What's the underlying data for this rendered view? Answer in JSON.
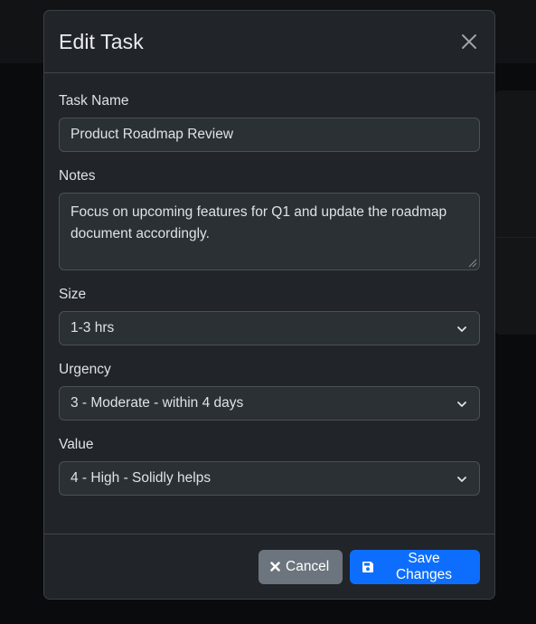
{
  "modal": {
    "title": "Edit Task"
  },
  "form": {
    "task_name": {
      "label": "Task Name",
      "value": "Product Roadmap Review"
    },
    "notes": {
      "label": "Notes",
      "value": "Focus on upcoming features for Q1 and update the roadmap document accordingly."
    },
    "size": {
      "label": "Size",
      "value": "1-3 hrs"
    },
    "urgency": {
      "label": "Urgency",
      "value": "3 - Moderate - within 4 days"
    },
    "value": {
      "label": "Value",
      "value": "4 - High - Solidly helps"
    }
  },
  "footer": {
    "cancel_label": "Cancel",
    "save_label": "Save Changes"
  },
  "icons": {
    "close": "close-icon",
    "chevron": "chevron-down-icon",
    "cancel": "x-icon",
    "save": "floppy-disk-icon"
  },
  "colors": {
    "modal_bg": "#212529",
    "input_bg": "#2b3035",
    "primary": "#0d6efd",
    "secondary": "#6c757d"
  }
}
